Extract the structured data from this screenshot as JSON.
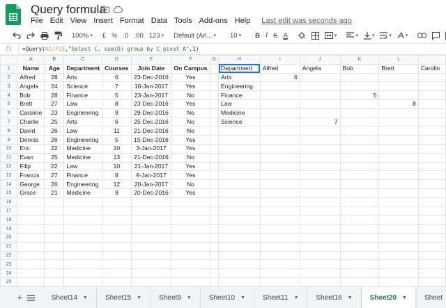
{
  "document": {
    "title": "Query formula",
    "last_edit": "Last edit was seconds ago"
  },
  "menu": [
    "File",
    "Edit",
    "View",
    "Insert",
    "Format",
    "Data",
    "Tools",
    "Add-ons",
    "Help"
  ],
  "toolbar": {
    "zoom": "100%",
    "currency": "£",
    "percent": "%",
    "decrease_decimals": ".0",
    "increase_decimals": ".00",
    "more_formats": "123",
    "font": "Default (Ari...",
    "font_size": "10",
    "bold": "B",
    "italic": "I",
    "strikethrough": "S",
    "text_color": "A"
  },
  "formula": {
    "fx": "fx",
    "parts": [
      "=Query(",
      "A1:F15",
      ",",
      "\"Select C, sum(D) group by C pivot A\"",
      ",1)"
    ]
  },
  "columns": [
    "A",
    "B",
    "C",
    "D",
    "E",
    "F",
    "G",
    "H",
    "I",
    "J",
    "K",
    "L"
  ],
  "source_headers": [
    "Name",
    "Age",
    "Department",
    "Courses",
    "Join Date",
    "On Campus"
  ],
  "source_rows": [
    [
      "Alfred",
      "28",
      "Arts",
      "6",
      "23-Dec-2016",
      "Yes"
    ],
    [
      "Angela",
      "24",
      "Science",
      "7",
      "16-Jan-2017",
      "Yes"
    ],
    [
      "Bob",
      "28",
      "Finance",
      "5",
      "23-Jan-2017",
      "No"
    ],
    [
      "Brett",
      "27",
      "Law",
      "8",
      "23-Dec-2016",
      "Yes"
    ],
    [
      "Caroline",
      "23",
      "Engineering",
      "9",
      "29-Dec-2016",
      "No"
    ],
    [
      "Charlie",
      "25",
      "Arts",
      "6",
      "25-Dec-2016",
      "No"
    ],
    [
      "David",
      "26",
      "Law",
      "11",
      "21-Dec-2016",
      "No"
    ],
    [
      "Dennis",
      "26",
      "Engineering",
      "5",
      "15-Dec-2016",
      "Yes"
    ],
    [
      "Eric",
      "22",
      "Medicine",
      "10",
      "3-Jan-2017",
      "Yes"
    ],
    [
      "Evan",
      "25",
      "Medicine",
      "13",
      "21-Dec-2016",
      "No"
    ],
    [
      "Filip",
      "22",
      "Law",
      "10",
      "21-Jan-2017",
      "Yes"
    ],
    [
      "Francis",
      "27",
      "Finance",
      "8",
      "9-Jan-2017",
      "Yes"
    ],
    [
      "George",
      "26",
      "Engineering",
      "12",
      "20-Jan-2017",
      "No"
    ],
    [
      "Grace",
      "21",
      "Medicine",
      "9",
      "20-Dec-2016",
      "Yes"
    ]
  ],
  "pivot_header": [
    "Department",
    "Alfred",
    "Angela",
    "Bob",
    "Brett",
    "Carolin"
  ],
  "pivot_rows": [
    [
      "Arts",
      "6",
      "",
      "",
      "",
      ""
    ],
    [
      "Engineering",
      "",
      "",
      "",
      "",
      ""
    ],
    [
      "Finance",
      "",
      "",
      "5",
      "",
      ""
    ],
    [
      "Law",
      "",
      "",
      "",
      "8",
      ""
    ],
    [
      "Medicine",
      "",
      "",
      "",
      "",
      ""
    ],
    [
      "Science",
      "",
      "7",
      "",
      "",
      ""
    ]
  ],
  "row_count": 26,
  "sheet_tabs": [
    "Sheet14",
    "Sheet15",
    "Sheet9",
    "Sheet10",
    "Sheet11",
    "Sheet16",
    "Sheet20",
    "Sheet"
  ],
  "active_sheet": "Sheet20"
}
